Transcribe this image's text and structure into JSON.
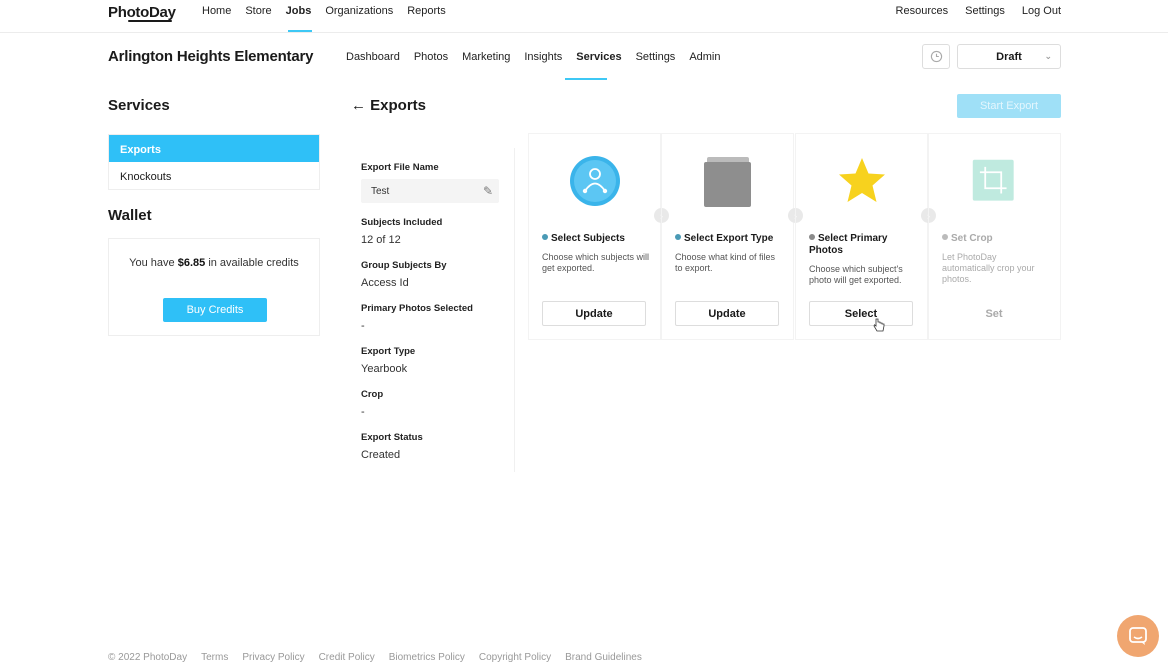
{
  "topnav": {
    "logo": "PhotoDay",
    "links": [
      "Home",
      "Store",
      "Jobs",
      "Organizations",
      "Reports"
    ],
    "active": "Jobs",
    "right_links": [
      "Resources",
      "Settings",
      "Log Out"
    ]
  },
  "job": {
    "title": "Arlington Heights Elementary",
    "tabs": [
      "Dashboard",
      "Photos",
      "Marketing",
      "Insights",
      "Services",
      "Settings",
      "Admin"
    ],
    "active_tab": "Services",
    "status": "Draft"
  },
  "sidebar": {
    "services_heading": "Services",
    "items": [
      "Exports",
      "Knockouts"
    ],
    "wallet_heading": "Wallet",
    "wallet_text_pre": "You have",
    "wallet_amount": "$6.85",
    "wallet_text_post": "in available credits",
    "buy_label": "Buy Credits"
  },
  "main": {
    "back_icon": "←",
    "heading": "Exports",
    "start_label": "Start Export",
    "summary": {
      "file_name_label": "Export File Name",
      "file_name_value": "Test",
      "subjects_label": "Subjects Included",
      "subjects_value": "12 of 12",
      "group_label": "Group Subjects By",
      "group_value": "Access Id",
      "primary_label": "Primary Photos Selected",
      "primary_value": "-",
      "type_label": "Export Type",
      "type_value": "Yearbook",
      "crop_label": "Crop",
      "crop_value": "-",
      "status_label": "Export Status",
      "status_value": "Created"
    },
    "steps": [
      {
        "title": "Select Subjects",
        "desc": "Choose which subjects will get exported.",
        "button": "Update",
        "icon": "subjects-icon"
      },
      {
        "title": "Select Export Type",
        "desc": "Choose what kind of files to export.",
        "button": "Update",
        "icon": "folder-icon"
      },
      {
        "title": "Select Primary Photos",
        "desc": "Choose which subject's photo will get exported.",
        "button": "Select",
        "icon": "star-icon"
      },
      {
        "title": "Set Crop",
        "desc": "Let PhotoDay automatically crop your photos.",
        "button": "Set",
        "icon": "crop-icon"
      }
    ]
  },
  "footer": {
    "links": [
      "© 2022 PhotoDay",
      "Terms",
      "Privacy Policy",
      "Credit Policy",
      "Biometrics Policy",
      "Copyright Policy",
      "Brand Guidelines"
    ]
  },
  "colors": {
    "accent": "#2fc0f7",
    "star": "#f7d21e",
    "chat": "#f0a670"
  }
}
